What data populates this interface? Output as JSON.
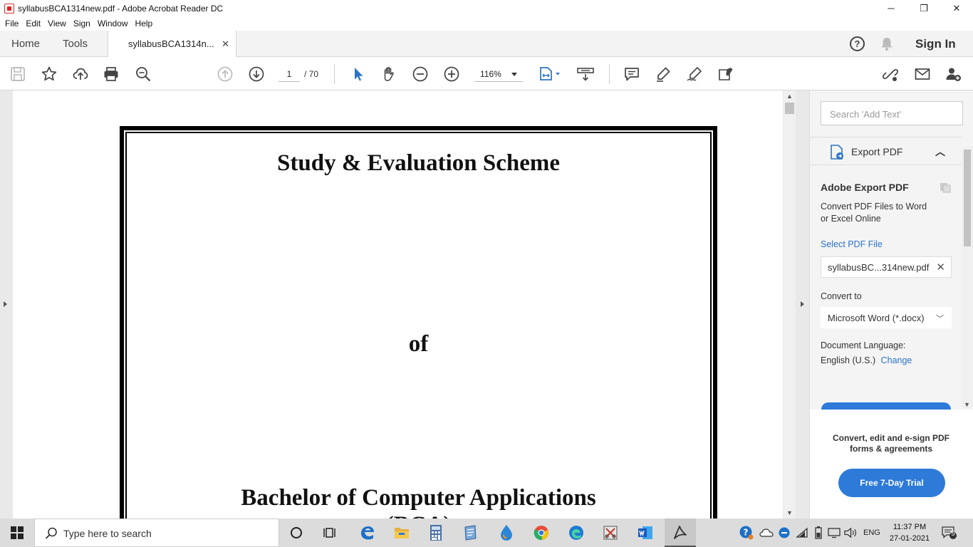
{
  "window": {
    "title": "syllabusBCA1314new.pdf - Adobe Acrobat Reader DC",
    "minimize": "─",
    "restore": "❐",
    "close": "✕"
  },
  "menu": [
    "File",
    "Edit",
    "View",
    "Sign",
    "Window",
    "Help"
  ],
  "tabs": {
    "home": "Home",
    "tools": "Tools",
    "doc": "syllabusBCA1314n...",
    "close": "✕",
    "help": "?",
    "signin": "Sign In"
  },
  "toolbar": {
    "page_current": "1",
    "page_total": "/  70",
    "zoom": "116%"
  },
  "document": {
    "line1": "Study & Evaluation Scheme",
    "line2": "of",
    "line3": "Bachelor of Computer Applications",
    "line4": "(BCA)"
  },
  "right_pane": {
    "search_placeholder": "Search 'Add Text'",
    "section_title": "Export PDF",
    "panel_title": "Adobe Export PDF",
    "description_1": "Convert PDF Files to Word",
    "description_2": "or Excel Online",
    "select_label": "Select PDF File",
    "selected_file": "syllabusBC...314new.pdf",
    "convert_label": "Convert to",
    "convert_value": "Microsoft Word (*.docx)",
    "lang_label": "Document Language:",
    "lang_value": "English (U.S.)",
    "lang_change": "Change",
    "promo_text": "Convert, edit and e-sign PDF forms & agreements",
    "promo_button": "Free 7-Day Trial"
  },
  "taskbar": {
    "search_placeholder": "Type here to search",
    "lang": "ENG",
    "time": "11:37 PM",
    "date": "27-01-2021",
    "notification_count": "5"
  },
  "colors": {
    "accent_blue": "#2d7ad9",
    "link_blue": "#2b73c8"
  }
}
